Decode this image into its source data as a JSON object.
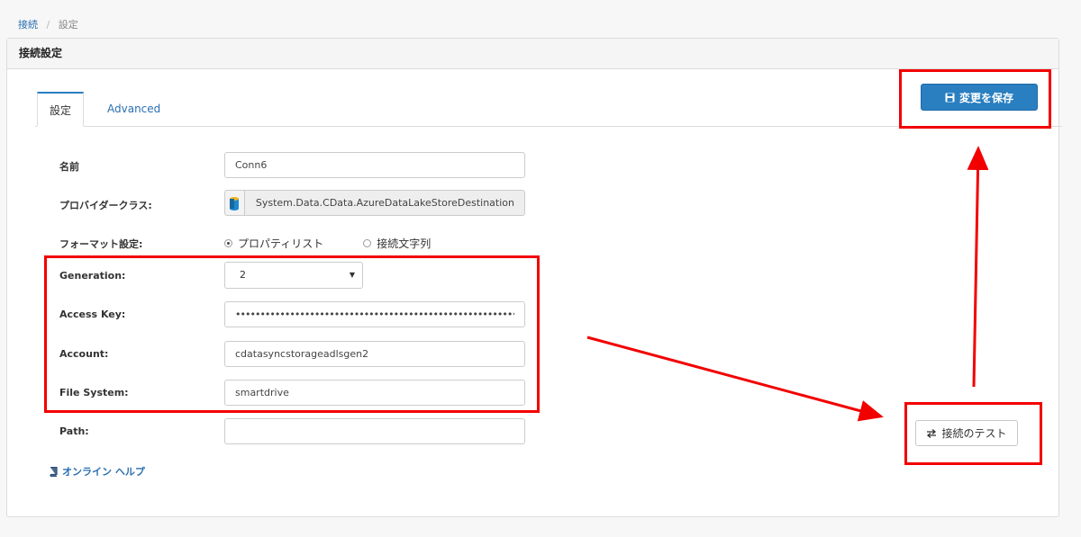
{
  "breadcrumb": {
    "parent": "接続",
    "current": "設定"
  },
  "panel": {
    "title": "接続設定"
  },
  "tabs": {
    "settings": "設定",
    "advanced": "Advanced"
  },
  "buttons": {
    "save": "変更を保存",
    "test": "接続のテスト"
  },
  "form": {
    "name_label": "名前",
    "name_value": "Conn6",
    "provider_label": "プロバイダークラス:",
    "provider_value": "System.Data.CData.AzureDataLakeStoreDestination",
    "format_label": "フォーマット設定:",
    "format_option_properties": "プロパティリスト",
    "format_option_connstring": "接続文字列",
    "generation_label": "Generation:",
    "generation_value": "2",
    "access_key_label": "Access Key:",
    "access_key_value": "••••••••••••••••••••••••••••••••••••••••••••••••••••••••••",
    "account_label": "Account:",
    "account_value": "cdatasyncstorageadlsgen2",
    "file_system_label": "File System:",
    "file_system_value": "smartdrive",
    "path_label": "Path:",
    "path_value": ""
  },
  "help": {
    "label": "オンライン ヘルプ"
  },
  "colors": {
    "primary": "#2a7fc0",
    "annotation": "#f20000"
  },
  "icons": {
    "save": "floppy-disk-icon",
    "test": "exchange-arrows-icon",
    "provider": "database-cylinder-icon",
    "help": "book-icon"
  }
}
